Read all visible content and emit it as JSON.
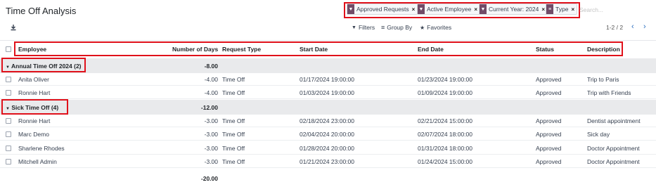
{
  "page": {
    "title": "Time Off Analysis"
  },
  "search": {
    "facets": [
      {
        "icon": "filter-icon",
        "label": "Approved Requests"
      },
      {
        "icon": "filter-icon",
        "label": "Active Employee"
      },
      {
        "icon": "filter-icon",
        "label": "Current Year: 2024"
      },
      {
        "icon": "group-by-icon",
        "label": "Type"
      }
    ],
    "placeholder": "Search..."
  },
  "toolbar": {
    "filters_label": "Filters",
    "groupby_label": "Group By",
    "favorites_label": "Favorites",
    "pager_text": "1-2 / 2"
  },
  "table": {
    "headers": [
      "Employee",
      "Number of Days",
      "Request Type",
      "Start Date",
      "End Date",
      "Status",
      "Description"
    ],
    "groups": [
      {
        "label": "Annual Time Off 2024 (2)",
        "total": "-8.00",
        "rows": [
          {
            "employee": "Anita Oliver",
            "days": "-4.00",
            "type": "Time Off",
            "start": "01/17/2024 19:00:00",
            "end": "01/23/2024 19:00:00",
            "status": "Approved",
            "description": "Trip to Paris"
          },
          {
            "employee": "Ronnie Hart",
            "days": "-4.00",
            "type": "Time Off",
            "start": "01/03/2024 19:00:00",
            "end": "01/09/2024 19:00:00",
            "status": "Approved",
            "description": "Trip with Friends"
          }
        ]
      },
      {
        "label": "Sick Time Off (4)",
        "total": "-12.00",
        "rows": [
          {
            "employee": "Ronnie Hart",
            "days": "-3.00",
            "type": "Time Off",
            "start": "02/18/2024 23:00:00",
            "end": "02/21/2024 15:00:00",
            "status": "Approved",
            "description": "Dentist appointment"
          },
          {
            "employee": "Marc Demo",
            "days": "-3.00",
            "type": "Time Off",
            "start": "02/04/2024 20:00:00",
            "end": "02/07/2024 18:00:00",
            "status": "Approved",
            "description": "Sick day"
          },
          {
            "employee": "Sharlene Rhodes",
            "days": "-3.00",
            "type": "Time Off",
            "start": "01/28/2024 20:00:00",
            "end": "01/31/2024 18:00:00",
            "status": "Approved",
            "description": "Doctor Appointment"
          },
          {
            "employee": "Mitchell Admin",
            "days": "-3.00",
            "type": "Time Off",
            "start": "01/21/2024 23:00:00",
            "end": "01/24/2024 15:00:00",
            "status": "Approved",
            "description": "Doctor Appointment"
          }
        ]
      }
    ],
    "grand_total": "-20.00"
  },
  "colors": {
    "accent": "#714b67",
    "highlight": "#e0111b",
    "group_bg": "#e9eaec"
  }
}
